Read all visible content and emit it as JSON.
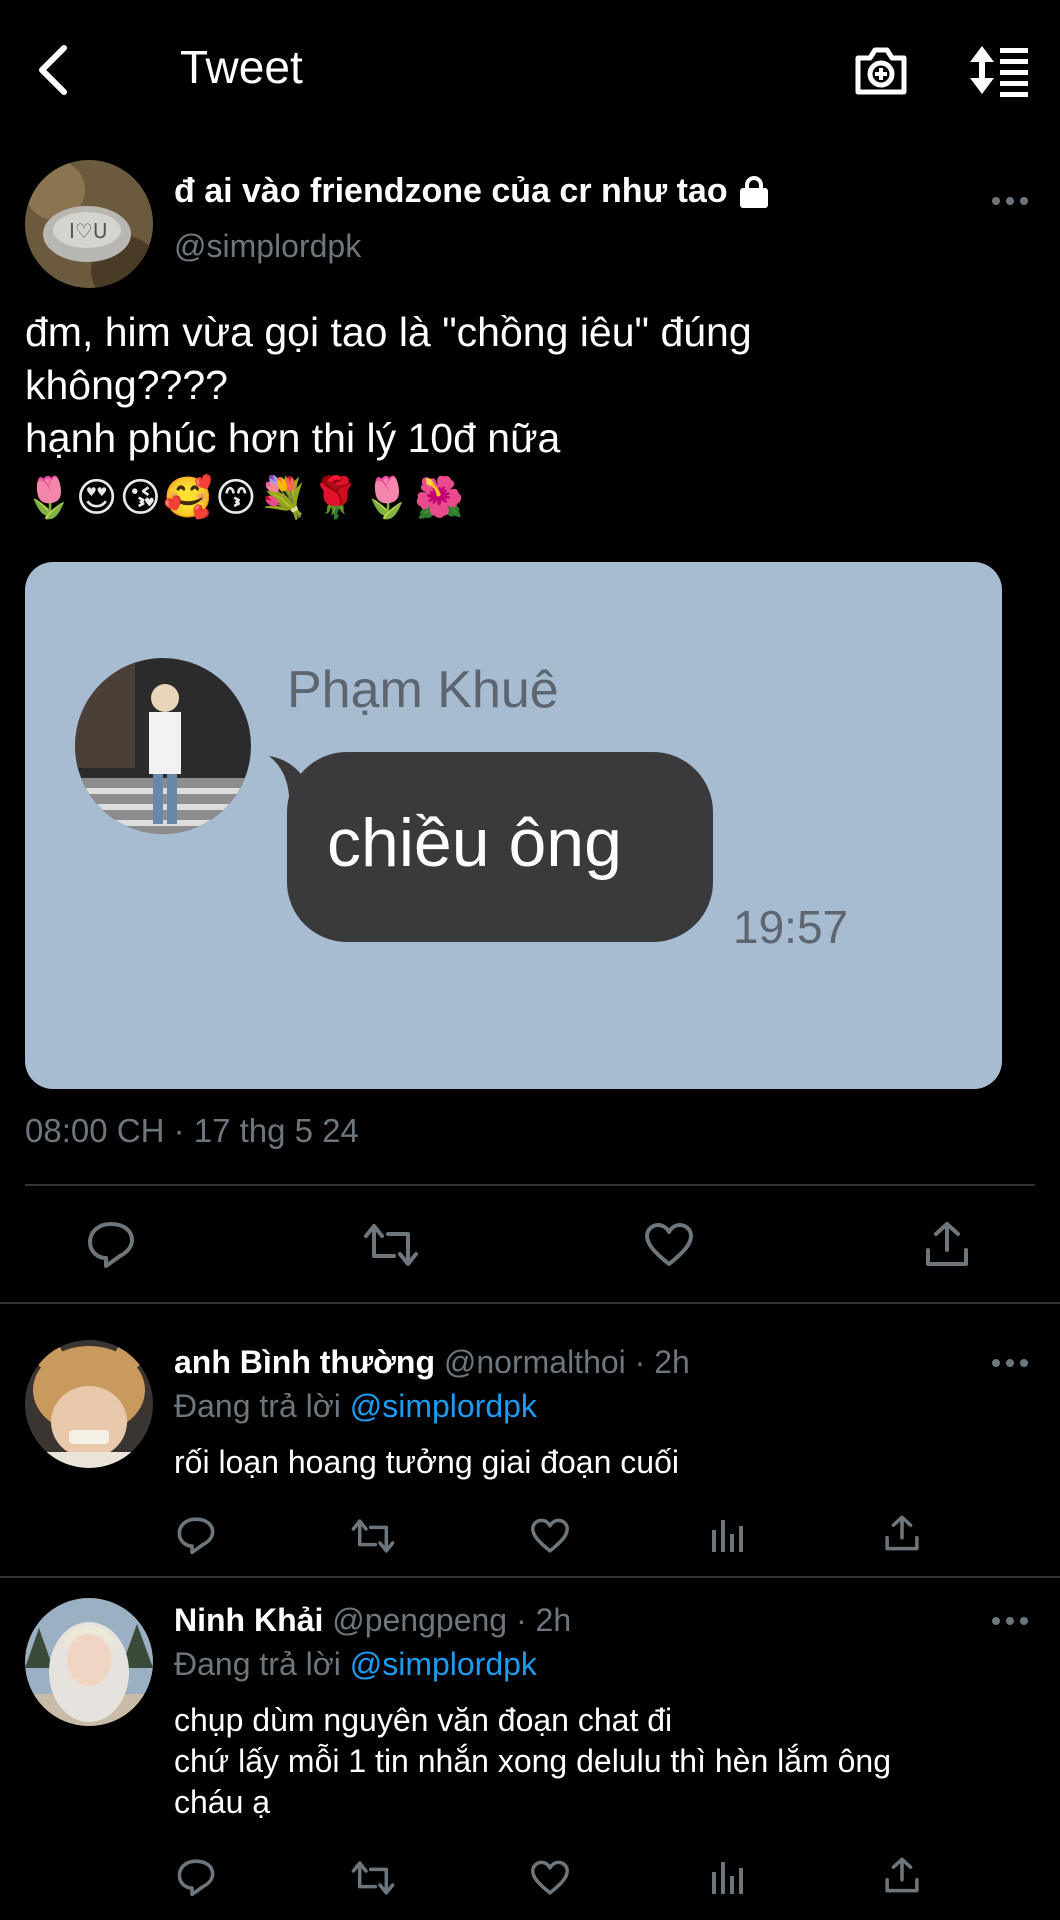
{
  "header": {
    "title": "Tweet",
    "back_icon": "arrow-left-icon",
    "camera_icon": "camera-plus-icon",
    "sort_icon": "sort-icon"
  },
  "tweet": {
    "author_name": "đ ai vào friendzone của cr như tao",
    "author_handle": "@simplordpk",
    "text": "đm, him vừa gọi tao là \"chồng iêu\" đúng\nkhông????\nhạnh phúc hơn thi lý 10đ nữa",
    "emojis": "🌷😍😘🥰😙💐🌹🌷🌺",
    "media": {
      "chat_name": "Phạm Khuê",
      "message": "chiều ông",
      "time": "19:57"
    },
    "timestamp": "08:00 CH · 17 thg 5 24"
  },
  "replies": [
    {
      "name": "anh Bình thường",
      "meta": "@normalthoi · 2h",
      "replying_label": "Đang trả lời",
      "replying_to": "@simplordpk",
      "text": "rối loạn hoang tưởng giai đoạn cuối"
    },
    {
      "name": "Ninh Khải",
      "meta": "@pengpeng · 2h",
      "replying_label": "Đang trả lời",
      "replying_to": "@simplordpk",
      "text": "chụp dùm nguyên văn đoạn chat đi\nchứ lấy mỗi 1 tin nhắn xong delulu thì hèn lắm ông\ncháu ạ"
    }
  ],
  "colors": {
    "background": "#000000",
    "secondary_text": "#6e767d",
    "link": "#1d9bf0",
    "media_bg": "#a7bbd1"
  }
}
